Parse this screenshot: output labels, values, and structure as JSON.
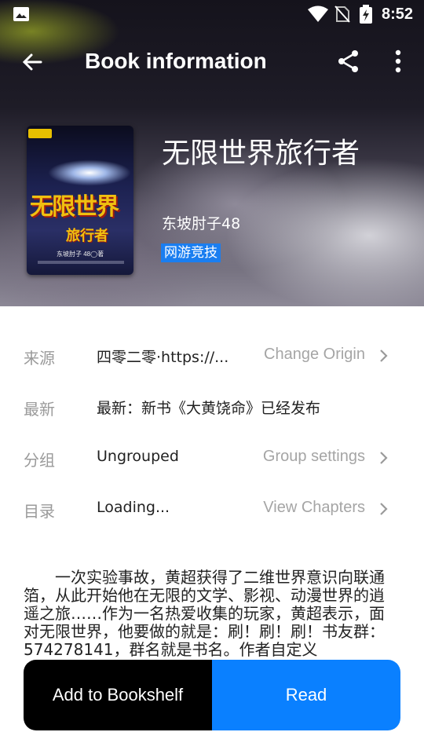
{
  "status_bar": {
    "time": "8:52",
    "icons": [
      "gallery-icon",
      "wifi-icon",
      "no-sim-icon",
      "battery-charging-icon"
    ]
  },
  "app_bar": {
    "title": "Book information",
    "icons": [
      "back-arrow-icon",
      "share-icon",
      "more-vert-icon"
    ]
  },
  "book": {
    "name": "无限世界旅行者",
    "author": "东坡肘子48",
    "tag": "网游竞技",
    "cover": {
      "title_line1": "无限世界",
      "title_line2": "旅行者",
      "byline": "东坡肘子 48◯著"
    }
  },
  "info": {
    "source": {
      "label": "来源",
      "value": "四零二零·https://...",
      "action": "Change Origin"
    },
    "latest": {
      "label": "最新",
      "value": "最新：新书《大黄饶命》已经发布"
    },
    "group": {
      "label": "分组",
      "value": "Ungrouped",
      "action": "Group settings"
    },
    "toc": {
      "label": "目录",
      "value": "Loading...",
      "action": "View Chapters"
    }
  },
  "intro": "一次实验事故，黄超获得了二维世界意识向联通箔，从此开始他在无限的文学、影视、动漫世界的逍遥之旅……作为一名热爱收集的玩家，黄超表示，面对无限世界，他要做的就是：刷！刷！刷！书友群：574278141，群名就是书名。作者自定义",
  "buttons": {
    "add_shelf": "Add to Bookshelf",
    "read": "Read"
  },
  "colors": {
    "accent": "#0a80ff",
    "tag_bg": "#1a7ef0",
    "shelf_button": "#000000"
  }
}
